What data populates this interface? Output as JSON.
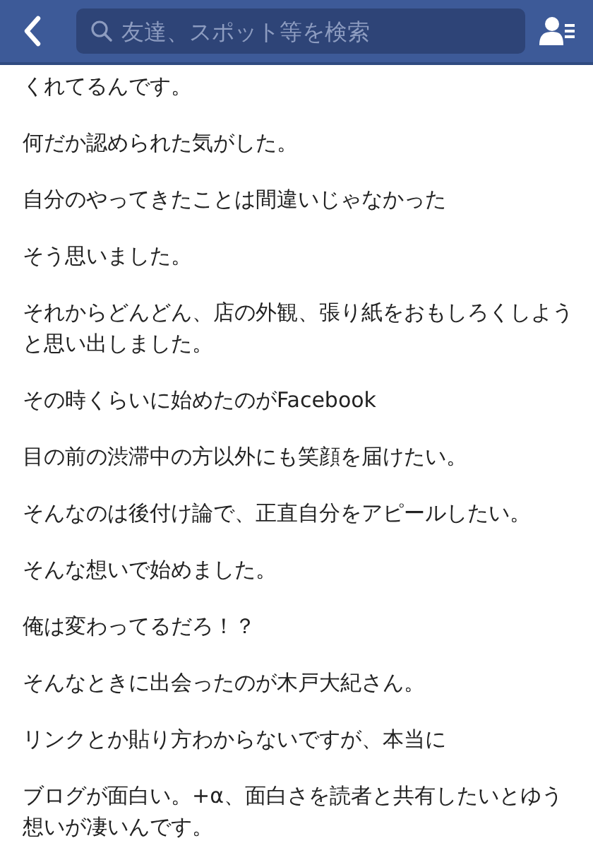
{
  "nav_bar": {
    "search": {
      "placeholder": "友達、スポット等を検索"
    }
  },
  "paragraphs": [
    "くれてるんです。",
    "何だか認められた気がした。",
    "自分のやってきたことは間違いじゃなかった",
    "そう思いました。",
    "それからどんどん、店の外観、張り紙をおもしろくしようと思い出しました。",
    "その時くらいに始めたのがFacebook",
    "目の前の渋滞中の方以外にも笑顔を届けたい。",
    "そんなのは後付け論で、正直自分をアピールしたい。",
    "そんな想いで始めました。",
    "俺は変わってるだろ！？",
    "そんなときに出会ったのが木戸大紀さん。",
    "リンクとか貼り方わからないですが、本当に",
    "ブログが面白い。+α、面白さを読者と共有したいとゆう想いが凄いんです。"
  ]
}
